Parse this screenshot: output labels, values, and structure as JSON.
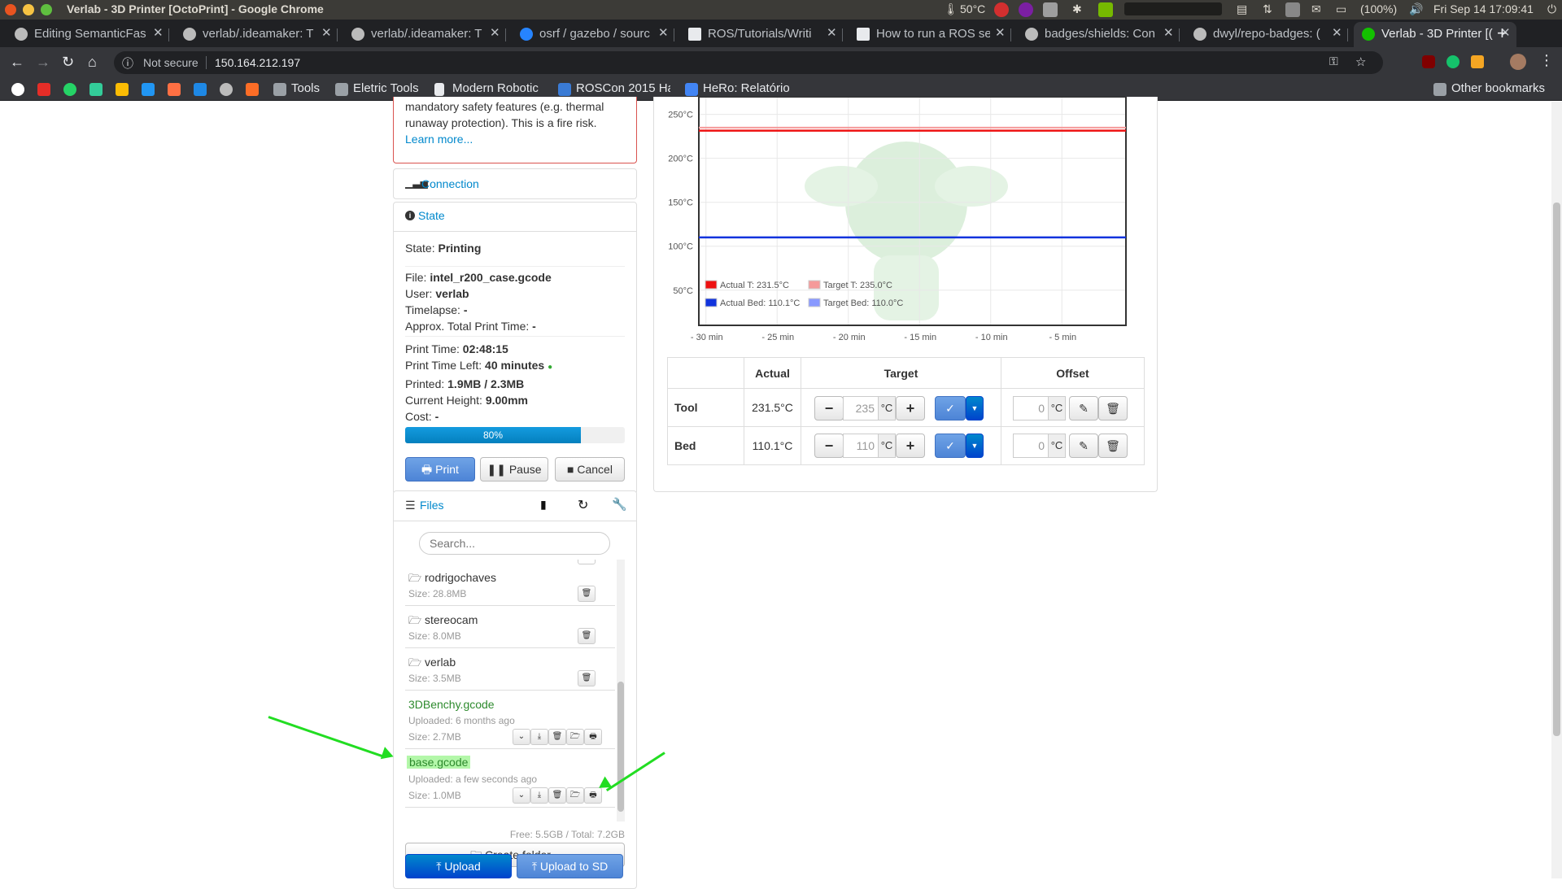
{
  "os": {
    "window_title": "Verlab - 3D Printer [OctoPrint] - Google Chrome",
    "temperature": "50°C",
    "battery": "(100%)",
    "datetime": "Fri Sep 14 17:09:41"
  },
  "tabs": [
    {
      "label": "Editing SemanticFas",
      "icon": "github-icon"
    },
    {
      "label": "verlab/.ideamaker: T",
      "icon": "github-icon"
    },
    {
      "label": "verlab/.ideamaker: T",
      "icon": "github-icon"
    },
    {
      "label": "osrf / gazebo / sourc",
      "icon": "bitbucket-icon"
    },
    {
      "label": "ROS/Tutorials/Writi",
      "icon": "ros-icon"
    },
    {
      "label": "How to run a ROS se",
      "icon": "ros-icon"
    },
    {
      "label": "badges/shields: Con",
      "icon": "github-icon"
    },
    {
      "label": "dwyl/repo-badges: (",
      "icon": "github-icon"
    },
    {
      "label": "Verlab - 3D Printer [(",
      "icon": "octoprint-icon",
      "active": true
    }
  ],
  "address": {
    "security": "Not secure",
    "url": "150.164.212.197"
  },
  "bookmarks": {
    "items": [
      "Tools",
      "Eletric Tools",
      "Modern Robotic",
      "ROSCon 2015 Ha",
      "HeRo: Relatório"
    ],
    "other": "Other bookmarks"
  },
  "warning": {
    "line1": "mandatory safety features (e.g. thermal",
    "line2": "runaway protection). This is a fire risk.",
    "link": "Learn more..."
  },
  "connection": {
    "title": "Connection"
  },
  "state": {
    "title": "State",
    "state_label": "State:",
    "state_value": "Printing",
    "file_label": "File:",
    "file_value": "intel_r200_case.gcode",
    "user_label": "User:",
    "user_value": "verlab",
    "timelapse_label": "Timelapse:",
    "timelapse_value": "-",
    "approx_label": "Approx. Total Print Time:",
    "approx_value": "-",
    "print_time_label": "Print Time:",
    "print_time_value": "02:48:15",
    "time_left_label": "Print Time Left:",
    "time_left_value": "40 minutes",
    "printed_label": "Printed:",
    "printed_value": "1.9MB / 2.3MB",
    "height_label": "Current Height:",
    "height_value": "9.00mm",
    "cost_label": "Cost:",
    "cost_value": "-",
    "progress": 0.8,
    "progress_text": "80%",
    "print_button": "Print",
    "pause_button": "Pause",
    "cancel_button": "Cancel"
  },
  "files": {
    "title": "Files",
    "search_placeholder": "Search...",
    "items": [
      {
        "name": "rodrigochaves",
        "size": "Size: 28.8MB",
        "type": "folder"
      },
      {
        "name": "stereocam",
        "size": "Size: 8.0MB",
        "type": "folder"
      },
      {
        "name": "verlab",
        "size": "Size: 3.5MB",
        "type": "folder"
      },
      {
        "name": "3DBenchy.gcode",
        "uploaded": "Uploaded: 6 months ago",
        "size": "Size: 2.7MB",
        "type": "file"
      },
      {
        "name": "base.gcode",
        "uploaded": "Uploaded: a few seconds ago",
        "size": "Size: 1.0MB",
        "type": "file",
        "highlight": true
      }
    ],
    "free": "Free: 5.5GB / Total: 7.2GB",
    "create_folder": "Create folder...",
    "upload": "Upload",
    "upload_sd": "Upload to SD"
  },
  "chart_data": {
    "type": "line",
    "title": "",
    "xlabel": "",
    "ylabel": "",
    "y_ticks": [
      "250°C",
      "200°C",
      "150°C",
      "100°C",
      "50°C"
    ],
    "y_tick_values": [
      250,
      200,
      150,
      100,
      50
    ],
    "x_ticks": [
      "- 30 min",
      "- 25 min",
      "- 20 min",
      "- 15 min",
      "- 10 min",
      "- 5 min"
    ],
    "x_tick_values": [
      -30,
      -25,
      -20,
      -15,
      -10,
      -5
    ],
    "xlim": [
      -30.5,
      -0.5
    ],
    "ylim": [
      10,
      270
    ],
    "grid": true,
    "legend_position": "bottom-left",
    "series": [
      {
        "name": "Actual T: 231.5°C",
        "color": "#ee1111",
        "values": [
          [
            -30.5,
            231.5
          ],
          [
            -0.5,
            231.5
          ]
        ]
      },
      {
        "name": "Target T: 235.0°C",
        "color": "#f59a9a",
        "values": [
          [
            -30.5,
            235.0
          ],
          [
            -0.5,
            235.0
          ]
        ]
      },
      {
        "name": "Actual Bed: 110.1°C",
        "color": "#1133dd",
        "values": [
          [
            -30.5,
            110.1
          ],
          [
            -0.5,
            110.1
          ]
        ]
      },
      {
        "name": "Target Bed: 110.0°C",
        "color": "#8899ff",
        "values": [
          [
            -30.5,
            110.0
          ],
          [
            -0.5,
            110.0
          ]
        ]
      }
    ]
  },
  "temp_table": {
    "headers": [
      "Actual",
      "Target",
      "Offset"
    ],
    "rows": [
      {
        "name": "Tool",
        "actual": "231.5°C",
        "target": "235",
        "offset": "0"
      },
      {
        "name": "Bed",
        "actual": "110.1°C",
        "target": "110",
        "offset": "0"
      }
    ],
    "unit": "°C"
  }
}
